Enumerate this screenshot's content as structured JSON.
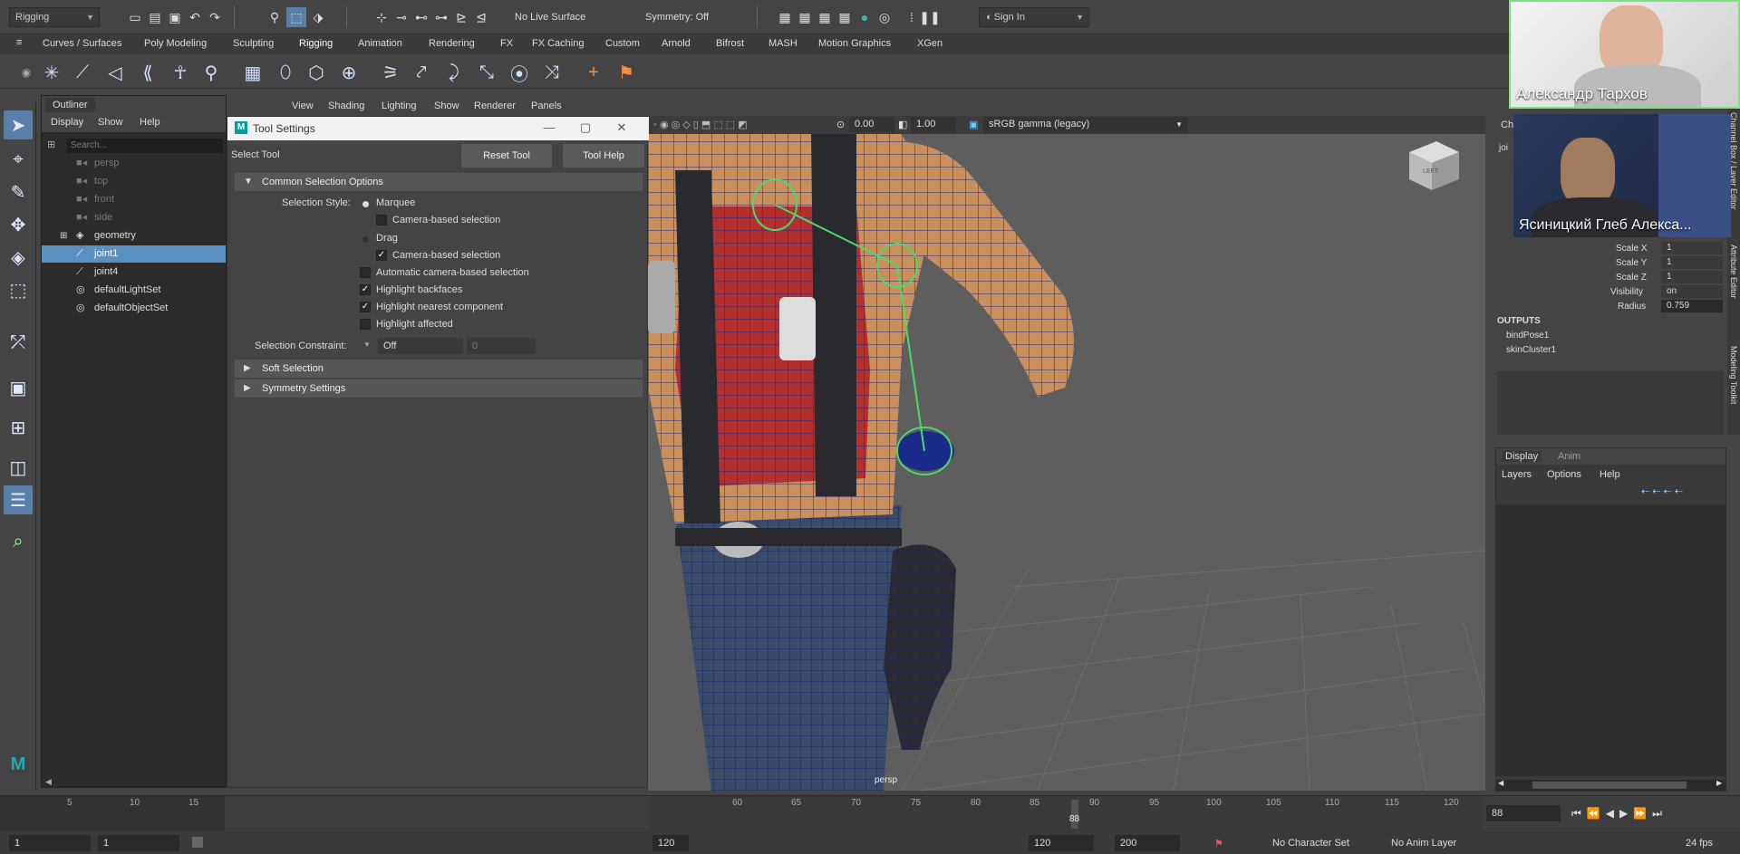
{
  "status": {
    "menu_set": "Rigging",
    "live_surface": "No Live Surface",
    "symmetry": "Symmetry: Off",
    "sign_in": "Sign In"
  },
  "shelf_tabs": [
    "Curves / Surfaces",
    "Poly Modeling",
    "Sculpting",
    "Rigging",
    "Animation",
    "Rendering",
    "FX",
    "FX Caching",
    "Custom",
    "Arnold",
    "Bifrost",
    "MASH",
    "Motion Graphics",
    "XGen"
  ],
  "outliner": {
    "tab": "Outliner",
    "menu": [
      "Display",
      "Show",
      "Help"
    ],
    "search_placeholder": "Search...",
    "items": [
      {
        "label": "persp"
      },
      {
        "label": "top"
      },
      {
        "label": "front"
      },
      {
        "label": "side"
      },
      {
        "label": "geometry"
      },
      {
        "label": "joint1"
      },
      {
        "label": "joint4"
      },
      {
        "label": "defaultLightSet"
      },
      {
        "label": "defaultObjectSet"
      }
    ]
  },
  "tool_settings": {
    "window_title": "Tool Settings",
    "tool_name": "Select Tool",
    "reset_button": "Reset Tool",
    "help_button": "Tool Help",
    "section_common": "Common Selection Options",
    "selection_style_label": "Selection Style:",
    "marquee": "Marquee",
    "camera_based_1": "Camera-based selection",
    "drag": "Drag",
    "camera_based_2": "Camera-based selection",
    "auto_camera": "Automatic camera-based selection",
    "highlight_backfaces": "Highlight backfaces",
    "highlight_nearest": "Highlight nearest component",
    "highlight_affected": "Highlight affected",
    "constraint_label": "Selection Constraint:",
    "constraint_value": "Off",
    "constraint_num": "0",
    "section_soft": "Soft Selection",
    "section_symmetry": "Symmetry Settings"
  },
  "viewport": {
    "menu": [
      "View",
      "Shading",
      "Lighting",
      "Show",
      "Renderer",
      "Panels"
    ],
    "exposure": "0.00",
    "gamma": "1.00",
    "color_space": "sRGB gamma (legacy)",
    "camera_label": "persp",
    "cube_label": "LEFT"
  },
  "channel_box": {
    "header_fragments": [
      "Ch",
      "joi"
    ],
    "attributes": [
      {
        "name": "Scale X",
        "value": "1"
      },
      {
        "name": "Scale Y",
        "value": "1"
      },
      {
        "name": "Scale Z",
        "value": "1"
      },
      {
        "name": "Visibility",
        "value": "on"
      },
      {
        "name": "Radius",
        "value": "0.759"
      }
    ],
    "outputs_title": "OUTPUTS",
    "outputs": [
      "bindPose1",
      "skinCluster1"
    ]
  },
  "side_tabs": [
    "Channel Box / Layer Editor",
    "Attribute Editor",
    "Modeling Toolkit"
  ],
  "layer_panel": {
    "tabs": [
      "Display",
      "Anim"
    ],
    "menu": [
      "Layers",
      "Options",
      "Help"
    ]
  },
  "video_participants": [
    {
      "name": "Александр Тархов"
    },
    {
      "name": "Ясиницкий Глеб Алекса..."
    }
  ],
  "timeline": {
    "left_ticks": [
      "5",
      "10",
      "15"
    ],
    "main_ticks": [
      "60",
      "65",
      "70",
      "75",
      "80",
      "85",
      "90",
      "95",
      "100",
      "105",
      "110",
      "115",
      "120"
    ],
    "current_frame_marker": "88",
    "current_frame": "88"
  },
  "range_bar": {
    "start": "1",
    "start2": "1",
    "end": "120",
    "end2": "120",
    "end3": "200",
    "character_set": "No Character Set",
    "anim_layer": "No Anim Layer",
    "fps": "24 fps"
  }
}
